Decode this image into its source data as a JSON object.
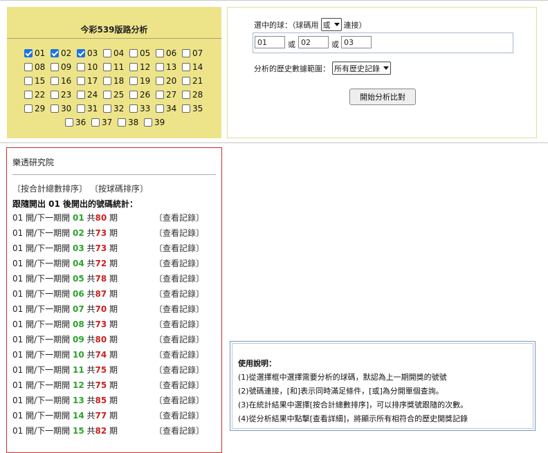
{
  "left_panel": {
    "title": "今彩539版路分析",
    "numbers": [
      {
        "n": "01",
        "on": true
      },
      {
        "n": "02",
        "on": true
      },
      {
        "n": "03",
        "on": true
      },
      {
        "n": "04",
        "on": false
      },
      {
        "n": "05",
        "on": false
      },
      {
        "n": "06",
        "on": false
      },
      {
        "n": "07",
        "on": false
      },
      {
        "n": "08",
        "on": false
      },
      {
        "n": "09",
        "on": false
      },
      {
        "n": "10",
        "on": false
      },
      {
        "n": "11",
        "on": false
      },
      {
        "n": "12",
        "on": false
      },
      {
        "n": "13",
        "on": false
      },
      {
        "n": "14",
        "on": false
      },
      {
        "n": "15",
        "on": false
      },
      {
        "n": "16",
        "on": false
      },
      {
        "n": "17",
        "on": false
      },
      {
        "n": "18",
        "on": false
      },
      {
        "n": "19",
        "on": false
      },
      {
        "n": "20",
        "on": false
      },
      {
        "n": "21",
        "on": false
      },
      {
        "n": "22",
        "on": false
      },
      {
        "n": "23",
        "on": false
      },
      {
        "n": "24",
        "on": false
      },
      {
        "n": "25",
        "on": false
      },
      {
        "n": "26",
        "on": false
      },
      {
        "n": "27",
        "on": false
      },
      {
        "n": "28",
        "on": false
      },
      {
        "n": "29",
        "on": false
      },
      {
        "n": "30",
        "on": false
      },
      {
        "n": "31",
        "on": false
      },
      {
        "n": "32",
        "on": false
      },
      {
        "n": "33",
        "on": false
      },
      {
        "n": "34",
        "on": false
      },
      {
        "n": "35",
        "on": false
      },
      {
        "n": "36",
        "on": false
      },
      {
        "n": "37",
        "on": false
      },
      {
        "n": "38",
        "on": false
      },
      {
        "n": "39",
        "on": false
      }
    ]
  },
  "right_panel": {
    "selected_label": "選中的球：（球碼用",
    "connector_value": "或",
    "connect_suffix": "連接）",
    "ball1": "01",
    "ball2": "02",
    "ball3": "03",
    "or_label": "或",
    "range_label": "分析的歷史數據範圍：",
    "range_value": "所有歷史記錄",
    "start_button": "開始分析比對"
  },
  "results": {
    "header": "樂透研究院",
    "sort_total": "〔按合計總數排序〕",
    "sort_number": "〔按球碼排序〕",
    "subtitle": "跟隨開出 01 後開出的號碼統計：",
    "row_prefix": "01 開/下一期開",
    "total_word": "共",
    "period_word": "期",
    "view_link": "〔查看記錄〕",
    "rows": [
      {
        "num": "01",
        "count": "80"
      },
      {
        "num": "02",
        "count": "73"
      },
      {
        "num": "03",
        "count": "73"
      },
      {
        "num": "04",
        "count": "72"
      },
      {
        "num": "05",
        "count": "78"
      },
      {
        "num": "06",
        "count": "87"
      },
      {
        "num": "07",
        "count": "70"
      },
      {
        "num": "08",
        "count": "73"
      },
      {
        "num": "09",
        "count": "80"
      },
      {
        "num": "10",
        "count": "74"
      },
      {
        "num": "11",
        "count": "75"
      },
      {
        "num": "12",
        "count": "75"
      },
      {
        "num": "13",
        "count": "85"
      },
      {
        "num": "14",
        "count": "77"
      },
      {
        "num": "15",
        "count": "82"
      }
    ]
  },
  "help": {
    "title": "使用說明：",
    "lines": [
      "(1)從選擇框中選擇需要分析的球碼，默認為上一期開獎的號號",
      "(2)號碼連接，[和]表示同時滿足條件，[或]為分開單個查詢。",
      "(3)在統計結果中選擇[按合計總數排序]，可以排序獎號跟隨的次數。",
      "(4)從分析結果中點擊[查看詳細]，將顯示所有相符合的歷史開獎記錄"
    ]
  }
}
